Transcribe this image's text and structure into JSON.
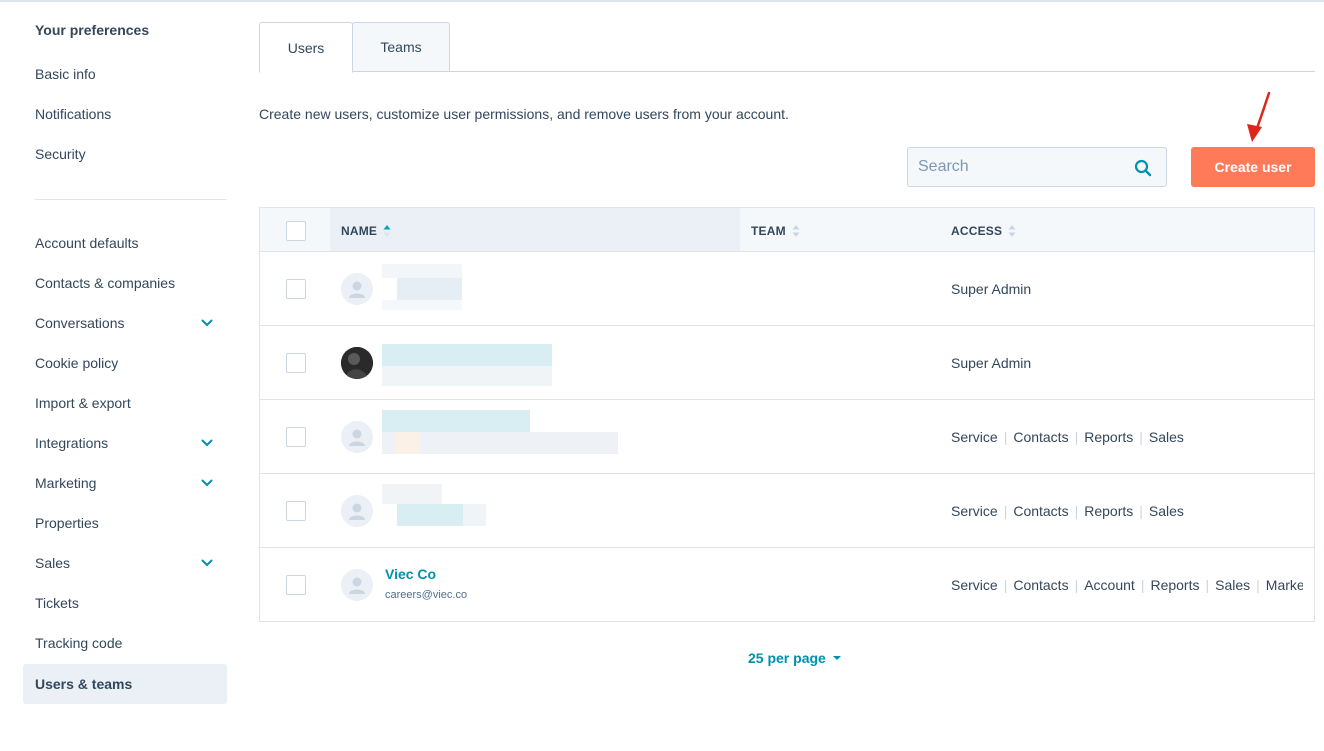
{
  "sidebar": {
    "heading": "Your preferences",
    "group1": [
      {
        "label": "Basic info"
      },
      {
        "label": "Notifications"
      },
      {
        "label": "Security"
      }
    ],
    "group2": [
      {
        "label": "Account defaults",
        "expandable": false
      },
      {
        "label": "Contacts & companies",
        "expandable": false
      },
      {
        "label": "Conversations",
        "expandable": true
      },
      {
        "label": "Cookie policy",
        "expandable": false
      },
      {
        "label": "Import & export",
        "expandable": false
      },
      {
        "label": "Integrations",
        "expandable": true
      },
      {
        "label": "Marketing",
        "expandable": true
      },
      {
        "label": "Properties",
        "expandable": false
      },
      {
        "label": "Sales",
        "expandable": true
      },
      {
        "label": "Tickets",
        "expandable": false
      },
      {
        "label": "Tracking code",
        "expandable": false
      },
      {
        "label": "Users & teams",
        "expandable": false,
        "active": true
      }
    ]
  },
  "tabs": [
    {
      "label": "Users",
      "active": true
    },
    {
      "label": "Teams",
      "active": false
    }
  ],
  "description": "Create new users, customize user permissions, and remove users from your account.",
  "search": {
    "placeholder": "Search",
    "icon": "search-icon"
  },
  "create_button": {
    "label": "Create user"
  },
  "table": {
    "columns": [
      {
        "label": "NAME",
        "sorted": "asc"
      },
      {
        "label": "TEAM",
        "sorted": null
      },
      {
        "label": "ACCESS",
        "sorted": null
      }
    ],
    "rows": [
      {
        "name": "",
        "email": "",
        "avatar": "default",
        "access": [
          "Super Admin"
        ]
      },
      {
        "name": "",
        "email": "",
        "avatar": "photo",
        "access": [
          "Super Admin"
        ]
      },
      {
        "name": "",
        "email": "",
        "avatar": "default",
        "access": [
          "Service",
          "Contacts",
          "Reports",
          "Sales"
        ]
      },
      {
        "name": "",
        "email": "",
        "avatar": "default",
        "access": [
          "Service",
          "Contacts",
          "Reports",
          "Sales"
        ]
      },
      {
        "name": "Viec Co",
        "email": "careers@viec.co",
        "avatar": "default",
        "access": [
          "Service",
          "Contacts",
          "Account",
          "Reports",
          "Sales",
          "Marke"
        ]
      }
    ]
  },
  "pagination": {
    "per_page_label": "25 per page"
  },
  "colors": {
    "accent": "#0091ae",
    "primary_button": "#ff7a59",
    "text": "#33475b",
    "border": "#dfe3eb",
    "annotation_arrow": "#e0251b"
  }
}
